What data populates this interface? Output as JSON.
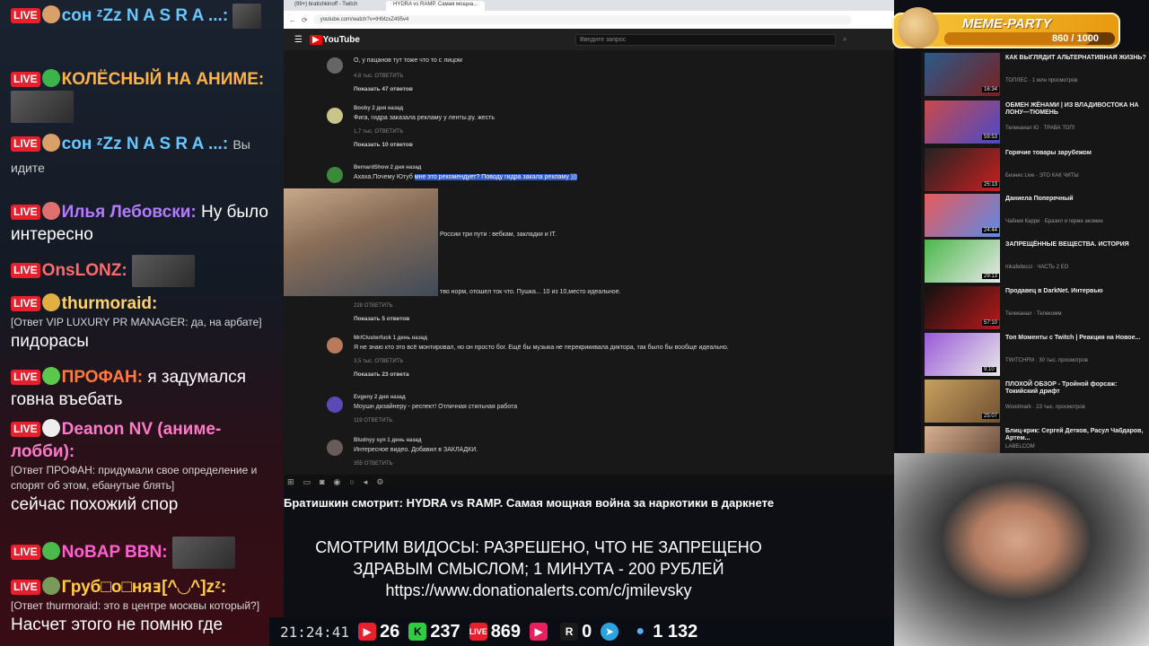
{
  "chat": {
    "messages": [
      {
        "user": "сон ᶻZz N A S R A ...:",
        "text": "",
        "color": "#67c7ff",
        "reply": ""
      },
      {
        "user": "КОЛЁСНЫЙ НА АНИМЕ:",
        "text": "",
        "color": "#ffb347",
        "reply": ""
      },
      {
        "user": "сон ᶻZz N A S R A ...:",
        "text": "Вы идите",
        "color": "#67c7ff",
        "reply": ""
      },
      {
        "user": "Илья Лебовски:",
        "text": "Ну было интересно",
        "color": "#b47bff",
        "reply": ""
      },
      {
        "user": "OnsLONZ:",
        "text": "",
        "color": "#ff6a6a",
        "reply": ""
      },
      {
        "user": "thurmoraid:",
        "text": "пидорасы",
        "color": "#ffd36a",
        "reply": "[Ответ VIP LUXURY PR MANAGER: да, на арбате]"
      },
      {
        "user": "ПРОФАН:",
        "text": "я задумался говна въебать",
        "color": "#ff7a3d",
        "reply": ""
      },
      {
        "user": "Deanon NV (аниме-лобби):",
        "text": "сейчас похожий спор",
        "color": "#ff7ac8",
        "reply": "[Ответ ПРОФАН: придумали свое определение и спорят об этом, ебанутые блять]"
      },
      {
        "user": "NoBAP BBN:",
        "text": "",
        "color": "#ff5fd0",
        "reply": ""
      },
      {
        "user": "Груб□о□няⱻ[^◡^]zᶻ:",
        "text": "Насчет этого не помню где",
        "color": "#ffcc44",
        "reply": "[Ответ thurmoraid: это в центре москвы который?]"
      }
    ]
  },
  "browser": {
    "tabs": [
      "(99+) bratishkinoff - Twitch",
      "HYDRA vs RAMP. Самая мощна..."
    ],
    "url": "youtube.com/watch?v=tHMzxZ495v4",
    "search_placeholder": "Введите запрос",
    "logo": "YouTube"
  },
  "comments": [
    {
      "name": "",
      "text": "О, у пацанов тут тоже что то с лицом",
      "meta": "4,8 тыс.   ОТВЕТИТЬ",
      "more": "Показать 47 ответов"
    },
    {
      "name": "Booby  2 дня назад",
      "text": "Фига, гидра заказала рекламу у ленты.ру. жесть",
      "meta": "1,7 тыс.   ОТВЕТИТЬ",
      "more": "Показать 10 ответов"
    },
    {
      "name": "BernardShow  2 дня назад",
      "text_plain": "Ахаха.Почему Ютуб ",
      "text_hl": "мне это рекомендует? Поводу гидра закала рекламу )))",
      "meta": "",
      "more": ""
    },
    {
      "name": "",
      "text": "России три пути : вебкам, закладки и IT.",
      "meta": "",
      "more": ""
    },
    {
      "name": "",
      "text": "тво норм, отошел ток что. Пушка... 10 из 10,место идеальное.",
      "meta": "228   ОТВЕТИТЬ",
      "more": "Показать 5 ответов"
    },
    {
      "name": "Mr/Clusterfuck  1 день назад",
      "text": "Я не знаю кто это всё монтировал, но он просто бог. Ещё бы музыка не перекрикивала диктора, так было бы вообще идеально.",
      "meta": "3,5 тыс.   ОТВЕТИТЬ",
      "more": "Показать 23 ответа"
    },
    {
      "name": "Evgeny  2 дня назад",
      "text": "Моушн дизайнеру - респект! Отличная стильная работа",
      "meta": "119   ОТВЕТИТЬ",
      "more": ""
    },
    {
      "name": "Bludnyy syn  1 день назад",
      "text": "Интересное видео. Добавил в ЗАКЛАДКИ.",
      "meta": "355   ОТВЕТИТЬ",
      "more": ""
    }
  ],
  "sidebar": [
    {
      "title": "КАК ВЫГЛЯДИТ АЛЬТЕРНАТИВНАЯ ЖИЗНЬ?",
      "sub": "ТОПЛЕС · 1 млн просмотров",
      "dur": "16:34"
    },
    {
      "title": "ОБМЕН ЖЁНАМИ | ИЗ ВЛАДИВОСТОКА НА ЛОНУ—ТЮМЕНЬ",
      "sub": "Телеканал Ю · ТРАВА ТОП!",
      "dur": "59:53"
    },
    {
      "title": "Горячие товары зарубежом",
      "sub": "Бизнес Live · ЭТО КАК ЧИТЫ",
      "dur": "25:13"
    },
    {
      "title": "Даниела Поперечный",
      "sub": "Чайник Карри · Бразил и герме акомин",
      "dur": "24:44"
    },
    {
      "title": "ЗАПРЕЩЁННЫЕ ВЕЩЕСТВА. ИСТОРИЯ",
      "sub": "Inkafeiteccl · ЧАСТЬ 2 ЕО",
      "dur": "29:13"
    },
    {
      "title": "Продавец в DarkNet. Интервью",
      "sub": "Телеканал · Телекомм",
      "dur": "57:10"
    },
    {
      "title": "Топ Моменты с Twitch | Реакция на Новое...",
      "sub": "TWITCHFM · 30 тыс. просмотров",
      "dur": "9:10"
    },
    {
      "title": "ПЛОХОЙ ОБЗОР - Тройной форсаж: Токийский дрифт",
      "sub": "Woodmark · 23 тыс. просмотров",
      "dur": "25:07"
    },
    {
      "title": "Блиц-крик: Сергей Детков, Расул Чабдаров, Артем...",
      "sub": "LABELCOM",
      "dur": ""
    }
  ],
  "meme_party": {
    "title": "MEME-PARTY",
    "count": "860 / 1000",
    "progress": 0.86
  },
  "stream": {
    "title": "Братишкин смотрит: HYDRA vs RAMP. Самая мощная война за наркотики в даркнете",
    "rules_line1": "СМОТРИМ ВИДОСЫ: РАЗРЕШЕНО, ЧТО НЕ ЗАПРЕЩЕНО",
    "rules_line2": "ЗДРАВЫМ СМЫСЛОМ; 1 МИНУТА - 200 РУБЛЕЙ",
    "rules_line3": "https://www.donationalerts.com/c/jmilevsky"
  },
  "status": {
    "clock": "21:24:41",
    "youtube": "26",
    "kick": "237",
    "live": "869",
    "play": "",
    "r": "0",
    "telegram": "",
    "viewers": "1 132"
  },
  "colors": {
    "accent": "#e8202d",
    "live": "#e8202d"
  }
}
